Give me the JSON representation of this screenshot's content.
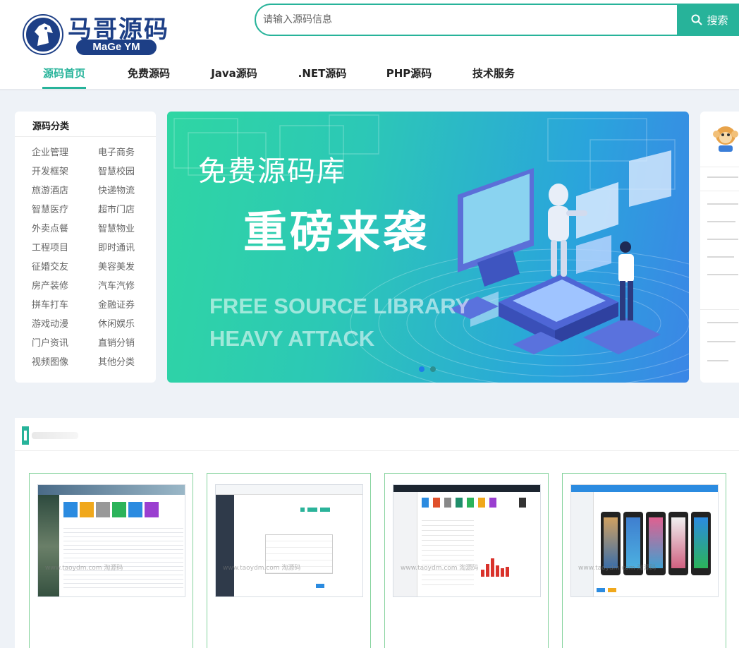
{
  "header": {
    "logo_cn": "马哥源码",
    "logo_en": "MaGe YM",
    "search_placeholder": "请输入源码信息",
    "search_button": "搜索"
  },
  "nav": {
    "items": [
      {
        "label": "源码首页",
        "active": true
      },
      {
        "label": "免费源码"
      },
      {
        "label": "Java源码"
      },
      {
        "label": ".NET源码"
      },
      {
        "label": "PHP源码"
      },
      {
        "label": "技术服务"
      }
    ]
  },
  "categories": {
    "title": "源码分类",
    "items": [
      "企业管理",
      "电子商务",
      "开发框架",
      "智慧校园",
      "旅游酒店",
      "快递物流",
      "智慧医疗",
      "超市门店",
      "外卖点餐",
      "智慧物业",
      "工程项目",
      "即时通讯",
      "征婚交友",
      "美容美发",
      "房产装修",
      "汽车汽修",
      "拼车打车",
      "金融证券",
      "游戏动漫",
      "休闲娱乐",
      "门户资讯",
      "直销分销",
      "视频图像",
      "其他分类"
    ]
  },
  "banner": {
    "line1": "免费源码库",
    "line2": "重磅来袭",
    "line3": "FREE SOURCE LIBRARY",
    "line4": "HEAVY ATTACK"
  },
  "cards": {
    "watermark": "www.taoydm.com 淘源码"
  },
  "colors": {
    "accent": "#27b39a",
    "brand": "#1d3f86",
    "card_border": "#86d39e"
  }
}
